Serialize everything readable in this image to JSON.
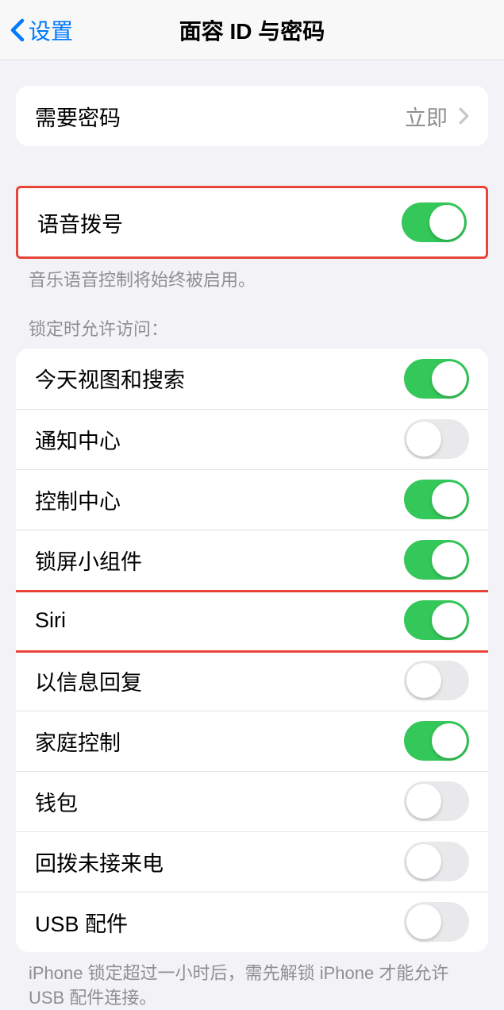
{
  "nav": {
    "back_label": "设置",
    "title": "面容 ID 与密码"
  },
  "passcode": {
    "require_label": "需要密码",
    "require_value": "立即"
  },
  "voice_dial": {
    "label": "语音拨号",
    "enabled": true,
    "footer": "音乐语音控制将始终被启用。"
  },
  "lock_access": {
    "header": "锁定时允许访问：",
    "items": [
      {
        "label": "今天视图和搜索",
        "enabled": true
      },
      {
        "label": "通知中心",
        "enabled": false
      },
      {
        "label": "控制中心",
        "enabled": true
      },
      {
        "label": "锁屏小组件",
        "enabled": true
      },
      {
        "label": "Siri",
        "enabled": true
      },
      {
        "label": "以信息回复",
        "enabled": false
      },
      {
        "label": "家庭控制",
        "enabled": true
      },
      {
        "label": "钱包",
        "enabled": false
      },
      {
        "label": "回拨未接来电",
        "enabled": false
      },
      {
        "label": "USB 配件",
        "enabled": false
      }
    ],
    "footer": "iPhone 锁定超过一小时后，需先解锁 iPhone 才能允许 USB 配件连接。"
  },
  "highlights": {
    "voice_dial_group": true,
    "siri_row": true
  }
}
